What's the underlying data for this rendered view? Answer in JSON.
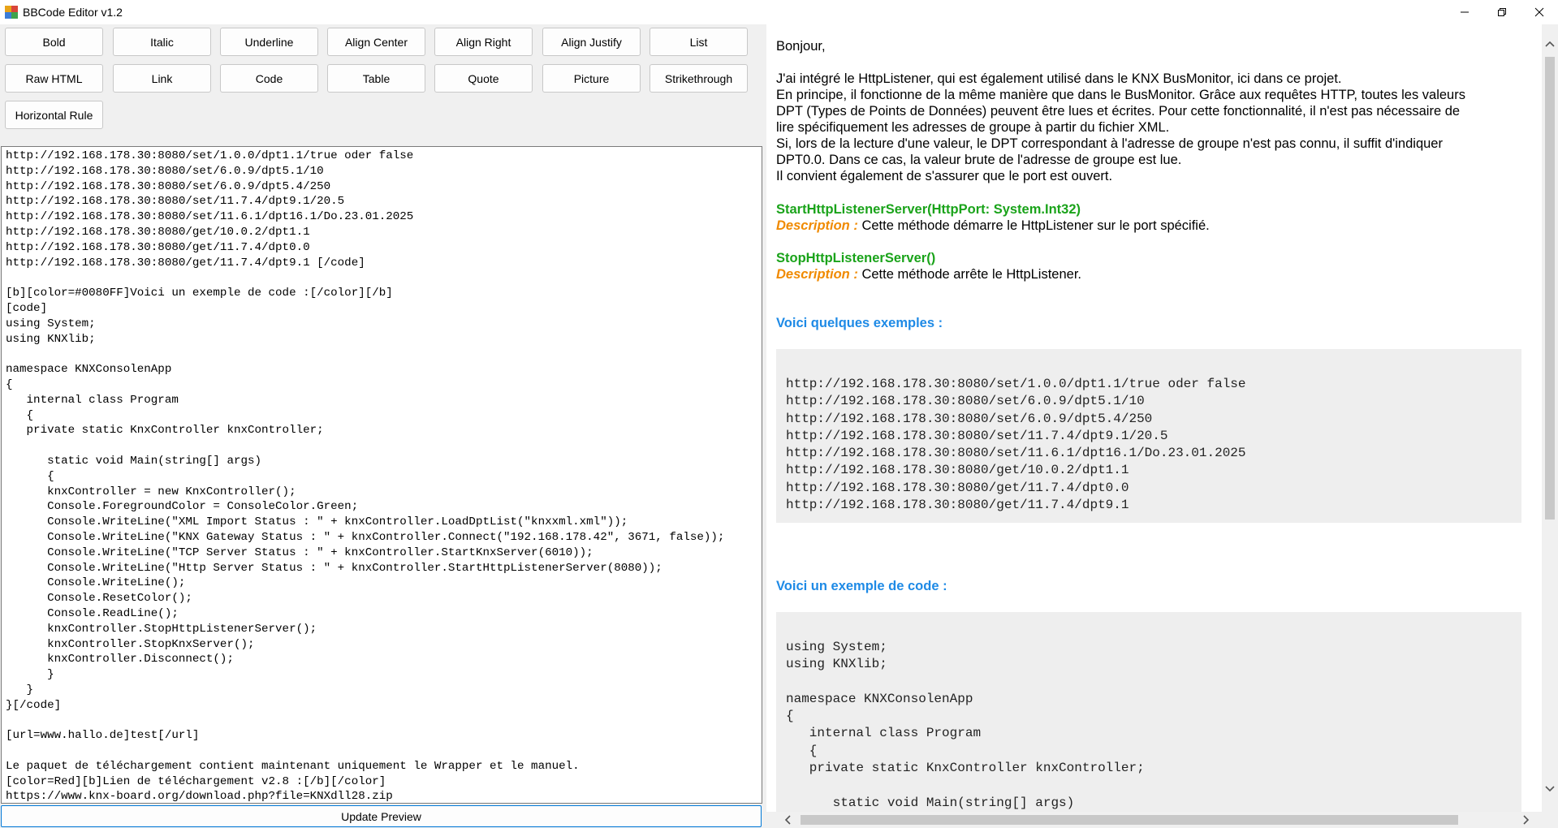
{
  "window": {
    "title": "BBCode Editor v1.2"
  },
  "toolbar": {
    "row1": [
      "Bold",
      "Italic",
      "Underline",
      "Align Center",
      "Align Right",
      "Align Justify",
      "List"
    ],
    "row2": [
      "Raw HTML",
      "Link",
      "Code",
      "Table",
      "Quote",
      "Picture",
      "Strikethrough"
    ],
    "row3": [
      "Horizontal Rule"
    ]
  },
  "editor": {
    "content": "http://192.168.178.30:8080/set/1.0.0/dpt1.1/true oder false\nhttp://192.168.178.30:8080/set/6.0.9/dpt5.1/10\nhttp://192.168.178.30:8080/set/6.0.9/dpt5.4/250\nhttp://192.168.178.30:8080/set/11.7.4/dpt9.1/20.5\nhttp://192.168.178.30:8080/set/11.6.1/dpt16.1/Do.23.01.2025\nhttp://192.168.178.30:8080/get/10.0.2/dpt1.1\nhttp://192.168.178.30:8080/get/11.7.4/dpt0.0\nhttp://192.168.178.30:8080/get/11.7.4/dpt9.1 [/code]\n\n[b][color=#0080FF]Voici un exemple de code :[/color][/b]\n[code]\nusing System;\nusing KNXlib;\n\nnamespace KNXConsolenApp\n{\n   internal class Program\n   {\n   private static KnxController knxController;\n\n      static void Main(string[] args)\n      {\n      knxController = new KnxController();\n      Console.ForegroundColor = ConsoleColor.Green;\n      Console.WriteLine(\"XML Import Status : \" + knxController.LoadDptList(\"knxxml.xml\"));\n      Console.WriteLine(\"KNX Gateway Status : \" + knxController.Connect(\"192.168.178.42\", 3671, false));\n      Console.WriteLine(\"TCP Server Status : \" + knxController.StartKnxServer(6010));\n      Console.WriteLine(\"Http Server Status : \" + knxController.StartHttpListenerServer(8080));\n      Console.WriteLine();\n      Console.ResetColor();\n      Console.ReadLine();\n      knxController.StopHttpListenerServer();\n      knxController.StopKnxServer();\n      knxController.Disconnect();\n      }\n   }\n}[/code]\n\n[url=www.hallo.de]test[/url]\n\nLe paquet de téléchargement contient maintenant uniquement le Wrapper et le manuel.\n[color=Red][b]Lien de téléchargement v2.8 :[/b][/color]\nhttps://www.knx-board.org/download.php?file=KNXdll28.zip"
  },
  "update_button": "Update Preview",
  "preview": {
    "greeting": "Bonjour,",
    "paragraph": [
      "J'ai intégré le HttpListener, qui est également utilisé dans le KNX BusMonitor, ici dans ce projet.",
      "En principe, il fonctionne de la même manière que dans le BusMonitor. Grâce aux requêtes HTTP, toutes les valeurs",
      "DPT (Types de Points de Données) peuvent être lues et écrites. Pour cette fonctionnalité, il n'est pas nécessaire de",
      "lire spécifiquement les adresses de groupe à partir du fichier XML.",
      "Si, lors de la lecture d'une valeur, le DPT correspondant à l'adresse de groupe n'est pas connu, il suffit d'indiquer",
      "DPT0.0. Dans ce cas, la valeur brute de l'adresse de groupe est lue.",
      "Il convient également de s'assurer que le port est ouvert."
    ],
    "method1": {
      "name": "StartHttpListenerServer(HttpPort: System.Int32)",
      "desc_label": "Description :",
      "desc_text": " Cette méthode démarre le HttpListener sur le port spécifié."
    },
    "method2": {
      "name": "StopHttpListenerServer()",
      "desc_label": "Description :",
      "desc_text": " Cette méthode arrête le HttpListener."
    },
    "examples_heading": "Voici quelques exemples :",
    "examples_code": "http://192.168.178.30:8080/set/1.0.0/dpt1.1/true oder false\nhttp://192.168.178.30:8080/set/6.0.9/dpt5.1/10\nhttp://192.168.178.30:8080/set/6.0.9/dpt5.4/250\nhttp://192.168.178.30:8080/set/11.7.4/dpt9.1/20.5\nhttp://192.168.178.30:8080/set/11.6.1/dpt16.1/Do.23.01.2025\nhttp://192.168.178.30:8080/get/10.0.2/dpt1.1\nhttp://192.168.178.30:8080/get/11.7.4/dpt0.0\nhttp://192.168.178.30:8080/get/11.7.4/dpt9.1",
    "code_heading": "Voici un exemple de code :",
    "code_sample": "using System;\nusing KNXlib;\n\nnamespace KNXConsolenApp\n{\n   internal class Program\n   {\n   private static KnxController knxController;\n\n      static void Main(string[] args)"
  },
  "colors": {
    "method_name": "#1aa31a",
    "description_label": "#f08a00",
    "heading": "#1e8ae6",
    "code_background": "#eeeeee"
  },
  "icons": {
    "minimize": "minimize-icon",
    "maximize": "restore-icon",
    "close": "close-icon",
    "scroll_up": "chevron-up-icon",
    "scroll_down": "chevron-down-icon",
    "scroll_left": "chevron-left-icon",
    "scroll_right": "chevron-right-icon"
  }
}
